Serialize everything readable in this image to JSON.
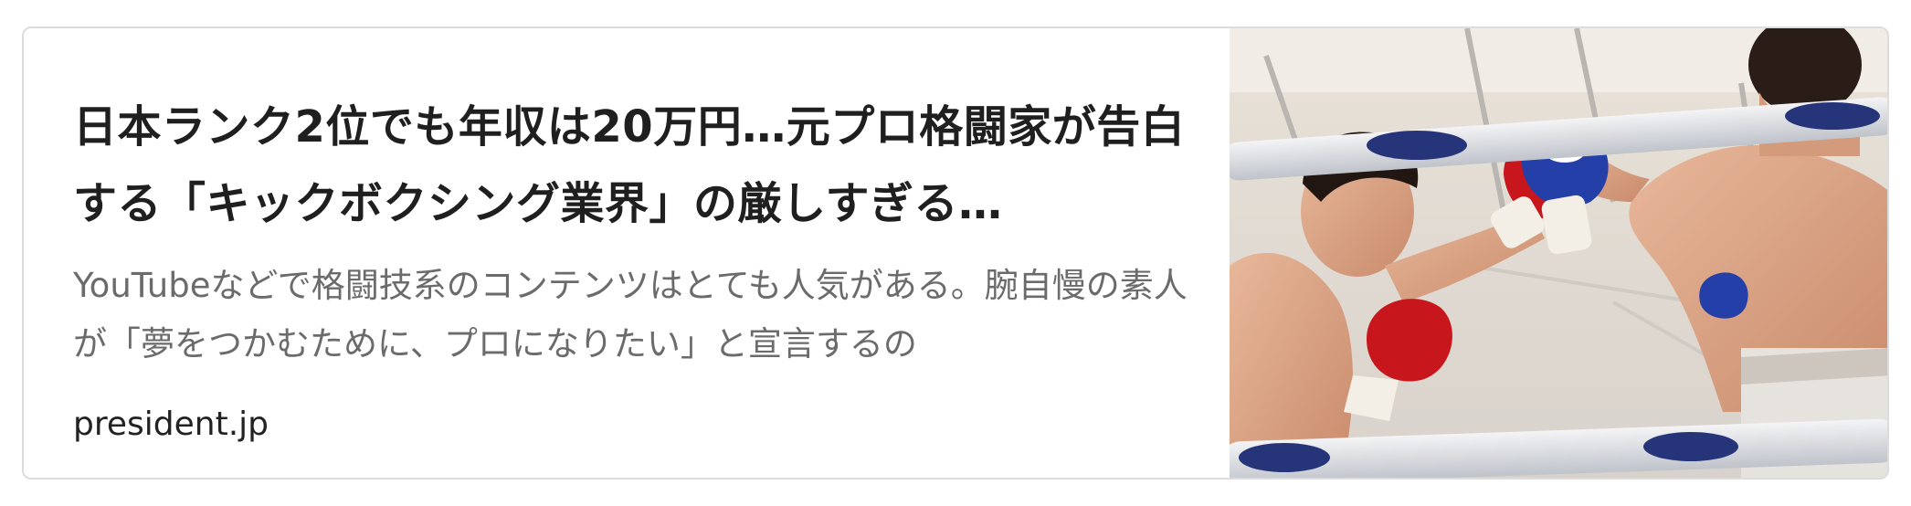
{
  "link_card": {
    "title": "日本ランク2位でも年収は20万円…元プロ格闘家が告白する「キックボクシング業界」の厳しすぎる…",
    "description": "YouTubeなどで格闘技系のコンテンツはとても人気がある。腕自慢の素人が「夢をつかむために、プロになりたい」と宣言するの",
    "domain": "president.jp",
    "thumbnail_alt": "キックボクシングの試合写真"
  },
  "colors": {
    "title": "#1f1f1f",
    "description": "#6b6b6b",
    "domain": "#222222",
    "border": "#dcdcdc",
    "glove_red": "#c8161d",
    "glove_blue": "#2440a8"
  }
}
